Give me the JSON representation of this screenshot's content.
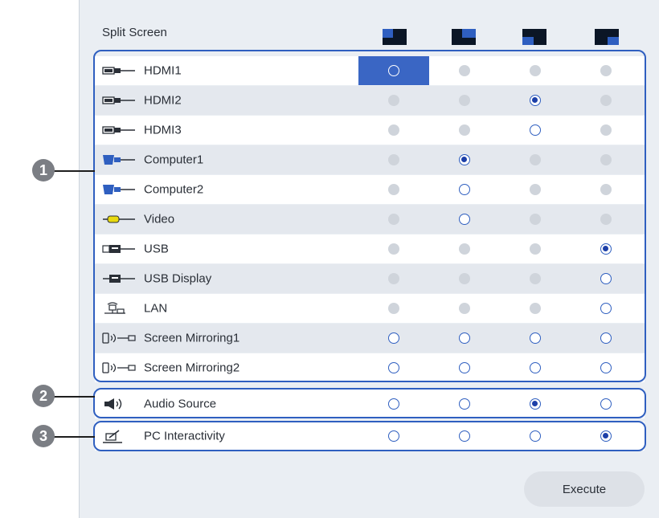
{
  "title": "Split Screen",
  "layout_icons": [
    "layout-full-icon",
    "layout-left-icon",
    "layout-right-icon",
    "layout-bottom-icon"
  ],
  "sources": [
    {
      "label": "HDMI1",
      "icon": "hdmi-plug-icon",
      "states": [
        "selected",
        "disabled",
        "disabled",
        "disabled"
      ]
    },
    {
      "label": "HDMI2",
      "icon": "hdmi-plug-icon",
      "states": [
        "disabled",
        "disabled",
        "checked",
        "disabled"
      ]
    },
    {
      "label": "HDMI3",
      "icon": "hdmi-plug-icon",
      "states": [
        "disabled",
        "disabled",
        "empty",
        "disabled"
      ]
    },
    {
      "label": "Computer1",
      "icon": "vga-plug-icon",
      "states": [
        "disabled",
        "checked",
        "disabled",
        "disabled"
      ]
    },
    {
      "label": "Computer2",
      "icon": "vga-plug-icon",
      "states": [
        "disabled",
        "empty",
        "disabled",
        "disabled"
      ]
    },
    {
      "label": "Video",
      "icon": "rca-plug-icon",
      "states": [
        "disabled",
        "empty",
        "disabled",
        "disabled"
      ]
    },
    {
      "label": "USB",
      "icon": "usb-plug-icon",
      "states": [
        "disabled",
        "disabled",
        "disabled",
        "checked"
      ]
    },
    {
      "label": "USB Display",
      "icon": "usb-display-icon",
      "states": [
        "disabled",
        "disabled",
        "disabled",
        "empty"
      ]
    },
    {
      "label": "LAN",
      "icon": "lan-icon",
      "states": [
        "disabled",
        "disabled",
        "disabled",
        "empty"
      ]
    },
    {
      "label": "Screen Mirroring1",
      "icon": "screen-mirroring-icon",
      "states": [
        "empty",
        "empty",
        "empty",
        "empty"
      ]
    },
    {
      "label": "Screen Mirroring2",
      "icon": "screen-mirroring-icon",
      "states": [
        "empty",
        "empty",
        "empty",
        "empty"
      ]
    }
  ],
  "audio": {
    "label": "Audio Source",
    "icon": "speaker-icon",
    "states": [
      "empty",
      "empty",
      "checked",
      "empty"
    ]
  },
  "interactivity": {
    "label": "PC Interactivity",
    "icon": "pen-icon",
    "states": [
      "empty",
      "empty",
      "empty",
      "checked"
    ]
  },
  "callouts": [
    "1",
    "2",
    "3"
  ],
  "execute_label": "Execute",
  "colors": {
    "accent": "#2f5fc0",
    "selected_cell": "#3a66c4",
    "panel": "#eaeef3",
    "callout": "#7b7e84"
  }
}
